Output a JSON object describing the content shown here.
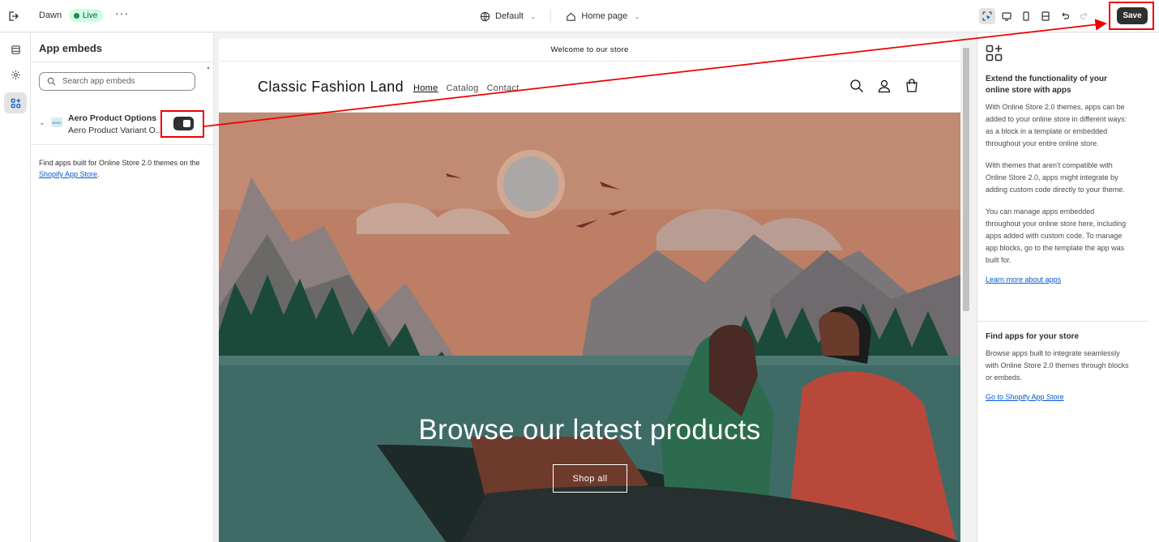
{
  "topbar": {
    "theme_name": "Dawn",
    "status_badge": "Live",
    "more_label": "···",
    "store_context": "Default",
    "page_selector": "Home page",
    "save_label": "Save"
  },
  "panel": {
    "title": "App embeds",
    "search_placeholder": "Search app embeds",
    "embed": {
      "logo_text": "AERO",
      "title": "Aero Product Options",
      "subtitle": "Aero Product Variant O...",
      "enabled": true
    },
    "find_apps_text": "Find apps built for Online Store 2.0 themes on the ",
    "find_apps_link": "Shopify App Store",
    "find_apps_end": "."
  },
  "preview": {
    "announcement": "Welcome to our store",
    "store_name": "Classic Fashion Land",
    "nav": [
      "Home",
      "Catalog",
      "Contact"
    ],
    "hero_title": "Browse our latest products",
    "hero_button": "Shop all"
  },
  "side": {
    "heading1": "Extend the functionality of your online store with apps",
    "para1": "With Online Store 2.0 themes, apps can be added to your online store in different ways: as a block in a template or embedded throughout your entire online store.",
    "para2": "With themes that aren't compatible with Online Store 2.0, apps might integrate by adding custom code directly to your theme.",
    "para3": "You can manage apps embedded throughout your online store here, including apps added with custom code. To manage app blocks, go to the template the app was built for.",
    "link1": "Learn more about apps",
    "heading2": "Find apps for your store",
    "para4": "Browse apps built to integrate seamlessly with Online Store 2.0 themes through blocks or embeds.",
    "link2": "Go to Shopify App Store"
  },
  "colors": {
    "accent_dark": "#303030",
    "live_badge_bg": "#cdfee1",
    "link": "#005bd3",
    "annotation": "#ee0000"
  }
}
